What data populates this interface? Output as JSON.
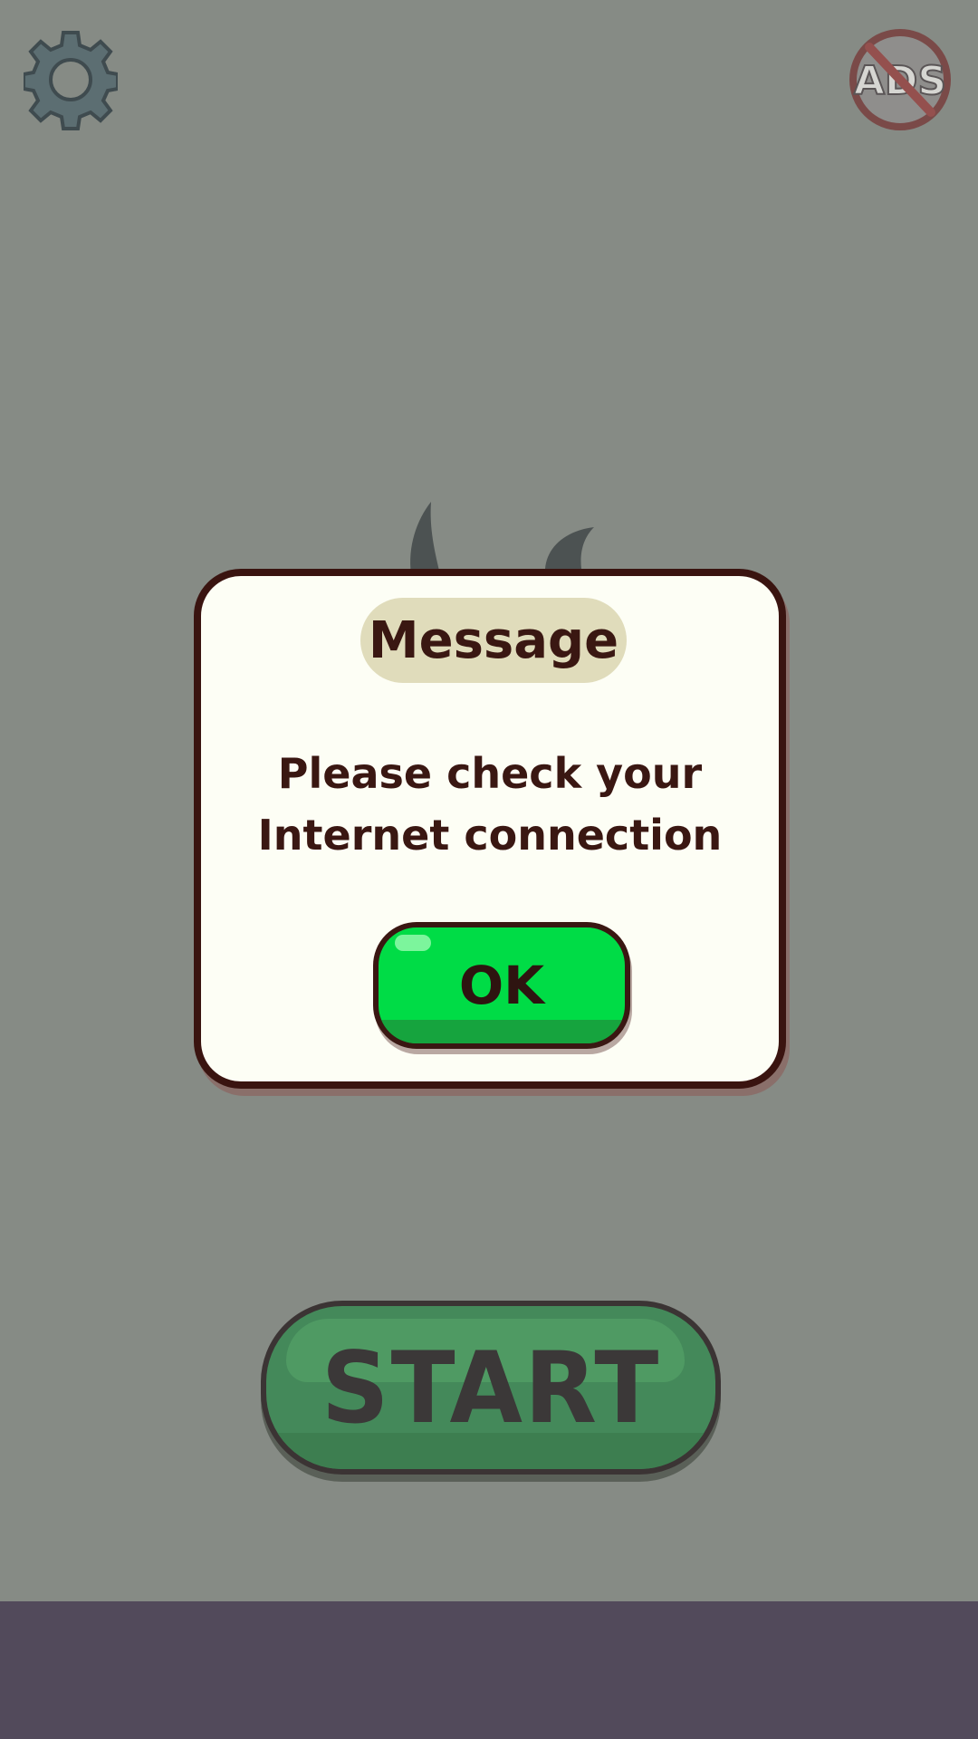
{
  "dialog": {
    "title": "Message",
    "message_line1": "Please check your",
    "message_line2": "Internet connection",
    "ok_label": "OK"
  },
  "menu": {
    "start_label": "START",
    "settings_icon": "gear-icon",
    "no_ads_icon": "no-ads-icon",
    "no_ads_text": "ADS"
  },
  "colors": {
    "overlay_background": "#868b85",
    "bottom_bar": "#524a5b",
    "dialog_fill": "#fdfef5",
    "dialog_border": "#3a1410",
    "ok_green": "#00dc46",
    "start_green_dimmed": "#44895a"
  }
}
